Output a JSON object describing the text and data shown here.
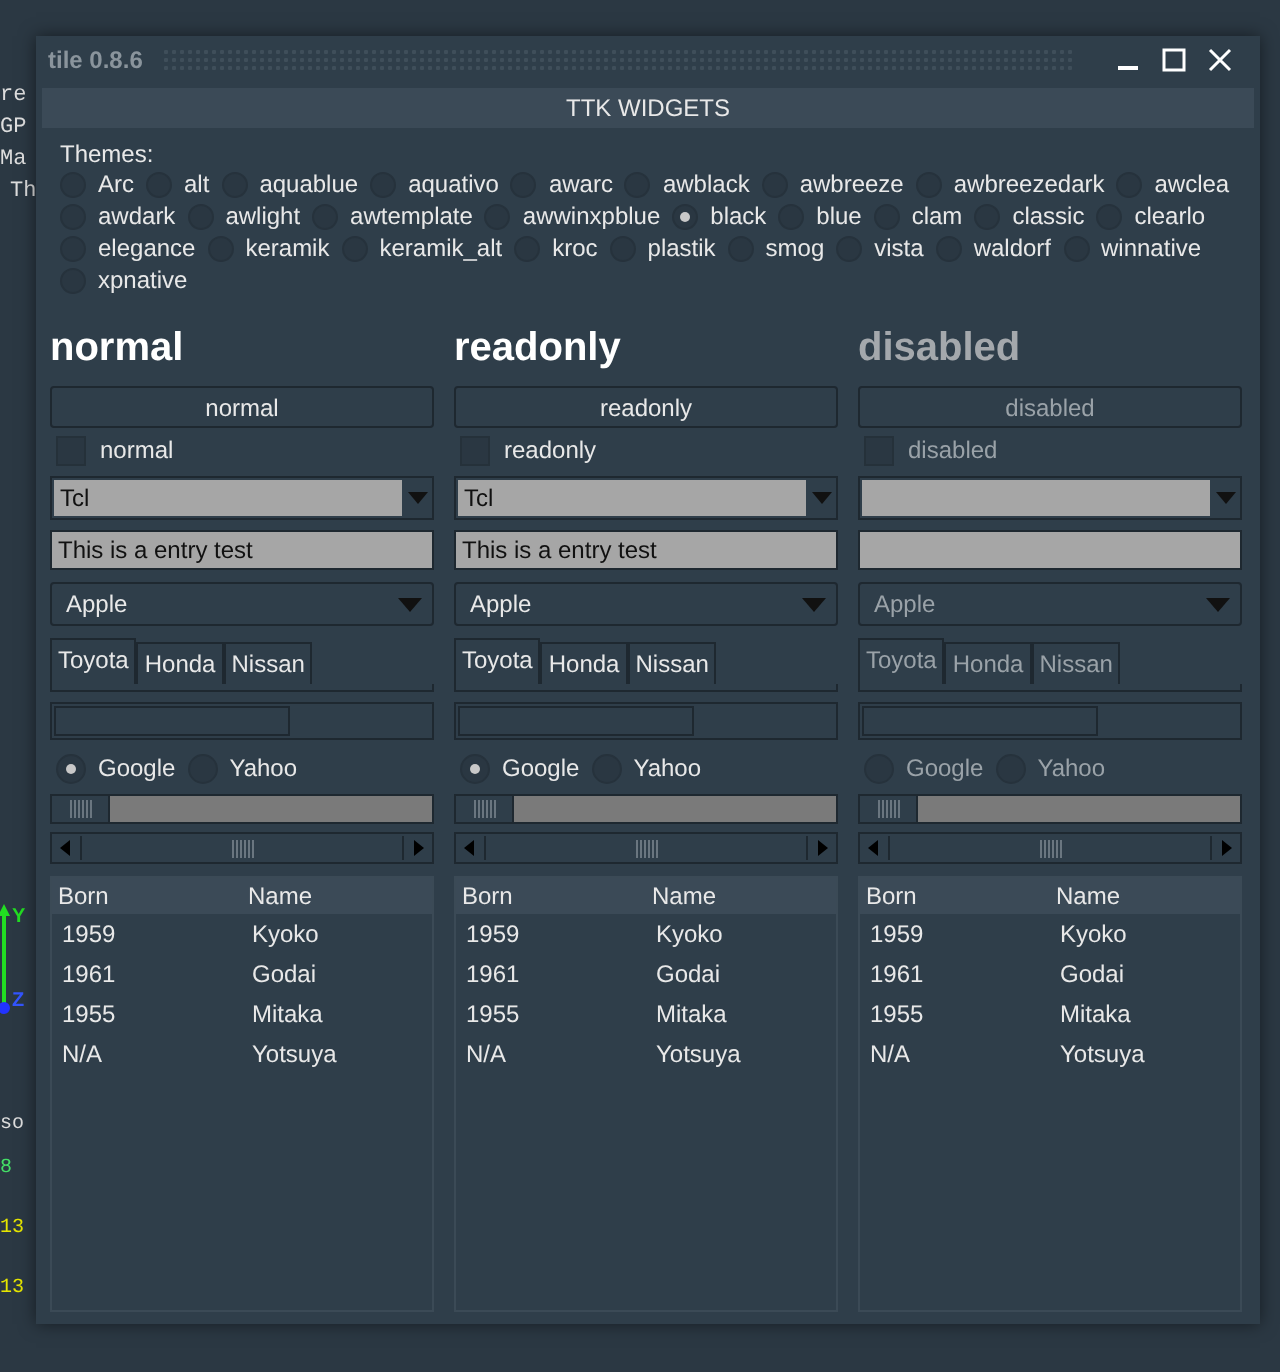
{
  "background": {
    "texts": [
      "re",
      "GP",
      "Ma",
      "Th"
    ],
    "axis_labels": [
      "Y",
      "Z"
    ],
    "lower_texts": [
      "so",
      "8",
      "13",
      "13"
    ]
  },
  "window": {
    "title": "tile 0.8.6",
    "header": "TTK WIDGETS"
  },
  "themes": {
    "label": "Themes:",
    "lines": [
      {
        "items": [
          {
            "label": "Arc",
            "selected": false
          },
          {
            "label": "alt",
            "selected": false
          },
          {
            "label": "aquablue",
            "selected": false
          },
          {
            "label": "aquativo",
            "selected": false
          },
          {
            "label": "awarc",
            "selected": false
          },
          {
            "label": "awblack",
            "selected": false
          },
          {
            "label": "awbreeze",
            "selected": false
          },
          {
            "label": "awbreezedark",
            "selected": false
          },
          {
            "label": "awclea",
            "selected": false
          }
        ]
      },
      {
        "items": [
          {
            "label": "awdark",
            "selected": false
          },
          {
            "label": "awlight",
            "selected": false
          },
          {
            "label": "awtemplate",
            "selected": false
          },
          {
            "label": "awwinxpblue",
            "selected": false
          },
          {
            "label": "black",
            "selected": true
          },
          {
            "label": "blue",
            "selected": false
          },
          {
            "label": "clam",
            "selected": false
          },
          {
            "label": "classic",
            "selected": false
          },
          {
            "label": "clearlo",
            "selected": false
          }
        ]
      },
      {
        "items": [
          {
            "label": "elegance",
            "selected": false
          },
          {
            "label": "keramik",
            "selected": false
          },
          {
            "label": "keramik_alt",
            "selected": false
          },
          {
            "label": "kroc",
            "selected": false
          },
          {
            "label": "plastik",
            "selected": false
          },
          {
            "label": "smog",
            "selected": false
          },
          {
            "label": "vista",
            "selected": false
          },
          {
            "label": "waldorf",
            "selected": false
          },
          {
            "label": "winnative",
            "selected": false
          }
        ]
      },
      {
        "items": [
          {
            "label": "xpnative",
            "selected": false
          }
        ]
      }
    ]
  },
  "columns": [
    {
      "title": "normal",
      "disabled": false,
      "button": "normal",
      "checkbox": {
        "label": "normal",
        "checked": false
      },
      "combo": "Tcl",
      "entry": "This is a entry test",
      "menu": "Apple",
      "tabs": [
        {
          "label": "Toyota",
          "selected": true
        },
        {
          "label": "Honda",
          "selected": false
        },
        {
          "label": "Nissan",
          "selected": false
        }
      ],
      "progress": {
        "level": 0.63
      },
      "radios": [
        {
          "label": "Google",
          "selected": true
        },
        {
          "label": "Yahoo",
          "selected": false
        }
      ],
      "table": {
        "columns": [
          "Born",
          "Name"
        ],
        "rows": [
          [
            "1959",
            "Kyoko"
          ],
          [
            "1961",
            "Godai"
          ],
          [
            "1955",
            "Mitaka"
          ],
          [
            "N/A",
            "Yotsuya"
          ]
        ]
      }
    },
    {
      "title": "readonly",
      "disabled": false,
      "button": "readonly",
      "checkbox": {
        "label": "readonly",
        "checked": false
      },
      "combo": "Tcl",
      "entry": "This is a entry test",
      "menu": "Apple",
      "tabs": [
        {
          "label": "Toyota",
          "selected": true
        },
        {
          "label": "Honda",
          "selected": false
        },
        {
          "label": "Nissan",
          "selected": false
        }
      ],
      "progress": {
        "level": 0.63
      },
      "radios": [
        {
          "label": "Google",
          "selected": true
        },
        {
          "label": "Yahoo",
          "selected": false
        }
      ],
      "table": {
        "columns": [
          "Born",
          "Name"
        ],
        "rows": [
          [
            "1959",
            "Kyoko"
          ],
          [
            "1961",
            "Godai"
          ],
          [
            "1955",
            "Mitaka"
          ],
          [
            "N/A",
            "Yotsuya"
          ]
        ]
      }
    },
    {
      "title": "disabled",
      "disabled": true,
      "button": "disabled",
      "checkbox": {
        "label": "disabled",
        "checked": false
      },
      "menu": "Apple",
      "tabs": [
        {
          "label": "Toyota",
          "selected": true
        },
        {
          "label": "Honda",
          "selected": false
        },
        {
          "label": "Nissan",
          "selected": false
        }
      ],
      "progress": {
        "level": 0.63
      },
      "radios": [
        {
          "label": "Google",
          "selected": false
        },
        {
          "label": "Yahoo",
          "selected": false
        }
      ],
      "table": {
        "columns": [
          "Born",
          "Name"
        ],
        "rows": [
          [
            "1959",
            "Kyoko"
          ],
          [
            "1961",
            "Godai"
          ],
          [
            "1955",
            "Mitaka"
          ],
          [
            "N/A",
            "Yotsuya"
          ]
        ]
      }
    }
  ]
}
